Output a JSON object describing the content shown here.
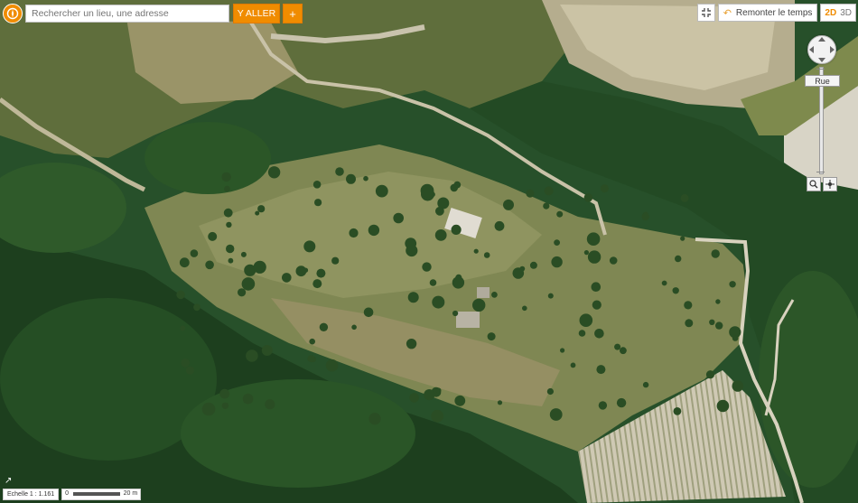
{
  "search": {
    "placeholder": "Rechercher un lieu, une adresse",
    "go_label": "Y ALLER",
    "plus_label": "+",
    "logo_icon": "compass-logo-icon"
  },
  "toolbar": {
    "fullscreen_icon": "collapse-fullscreen-icon",
    "time_label": "Remonter le temps",
    "time_icon": "undo-arrow-icon",
    "mode_2d": "2D",
    "mode_3d": "3D"
  },
  "navigation": {
    "zoom_label": "Rue",
    "zoom_level_fraction": 0.9,
    "zoom_out_icon": "magnifier-icon",
    "locate_icon": "crosshair-icon"
  },
  "scale": {
    "label": "Echelle 1 : 1.161",
    "zero": "0",
    "end": "20 m"
  },
  "map": {
    "type": "aerial-imagery"
  },
  "colors": {
    "accent": "#f08c00",
    "forest": "#1f4a22",
    "grass": "#8a8f58",
    "field": "#c8c3b0"
  }
}
